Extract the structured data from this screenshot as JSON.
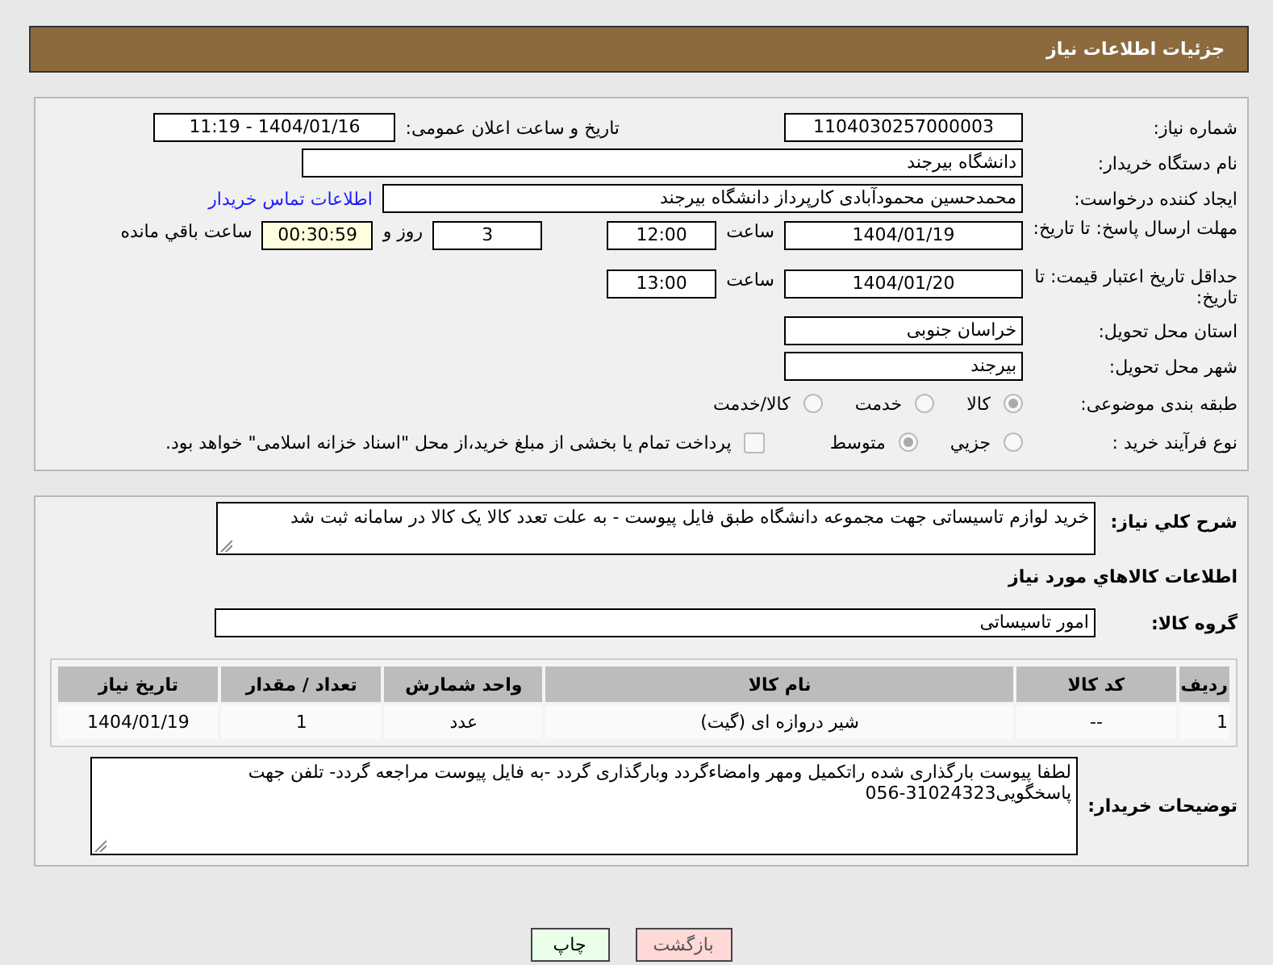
{
  "header": {
    "title": "جزئیات اطلاعات نیاز"
  },
  "need_number": {
    "label": "شماره نیاز:",
    "value": "1104030257000003"
  },
  "announcement": {
    "label": "تاریخ و ساعت اعلان عمومی:",
    "value": "1404/01/16 - 11:19"
  },
  "buyer": {
    "label": "نام دستگاه خریدار:",
    "value": "دانشگاه بیرجند"
  },
  "requester": {
    "label": "ایجاد کننده درخواست:",
    "value": "محمدحسین محمودآبادی کارپرداز دانشگاه بیرجند",
    "link": "اطلاعات تماس خریدار"
  },
  "reply_deadline": {
    "label": "مهلت ارسال پاسخ: تا تاریخ:",
    "date": "1404/01/19",
    "time_label": "ساعت",
    "time": "12:00",
    "days": "3",
    "days_label": "روز و",
    "remaining": "00:30:59",
    "remaining_label": "ساعت باقي مانده"
  },
  "price_validity": {
    "label": "حداقل تاریخ اعتبار قیمت: تا تاریخ:",
    "date": "1404/01/20",
    "time_label": "ساعت",
    "time": "13:00"
  },
  "province": {
    "label": "استان محل تحویل:",
    "value": "خراسان جنوبی"
  },
  "city": {
    "label": "شهر محل تحویل:",
    "value": "بیرجند"
  },
  "category": {
    "label": "طبقه بندی موضوعی:",
    "options": [
      {
        "label": "کالا",
        "selected": true
      },
      {
        "label": "خدمت",
        "selected": false
      },
      {
        "label": "کالا/خدمت",
        "selected": false
      }
    ]
  },
  "process": {
    "label": "نوع فرآیند خرید :",
    "options": [
      {
        "label": "جزیي",
        "selected": false
      },
      {
        "label": "متوسط",
        "selected": true
      }
    ],
    "payment": {
      "label": "پرداخت تمام یا بخشی از مبلغ خرید،از محل \"اسناد خزانه اسلامی\" خواهد بود.",
      "checked": false
    }
  },
  "description": {
    "label": "شرح کلي نياز:",
    "value": "خرید لوازم تاسیساتی جهت مجموعه دانشگاه طبق فایل پیوست - به علت تعدد کالا یک کالا در سامانه ثبت شد"
  },
  "goods_title": "اطلاعات کالاهاي مورد نياز",
  "goods_group": {
    "label": "گروه کالا:",
    "value": "امور تاسیساتی"
  },
  "table": {
    "columns": [
      "ردیف",
      "کد کالا",
      "نام کالا",
      "واحد شمارش",
      "تعداد / مقدار",
      "تاریخ نیاز"
    ],
    "rows": [
      [
        "1",
        "--",
        "شیر دروازه ای (گیت)",
        "عدد",
        "1",
        "1404/01/19"
      ]
    ]
  },
  "buyer_notes": {
    "label": "توضیحات خریدار:",
    "value": "لطفا پیوست بارگذاری شده راتکمیل ومهر وامضاءگردد وبارگذاری گردد -به فایل پیوست مراجعه گردد- تلفن جهت پاسخگویی31024323-056"
  },
  "buttons": [
    {
      "label": "بازگشت",
      "kind": "back"
    },
    {
      "label": "چاپ",
      "kind": "print"
    }
  ]
}
